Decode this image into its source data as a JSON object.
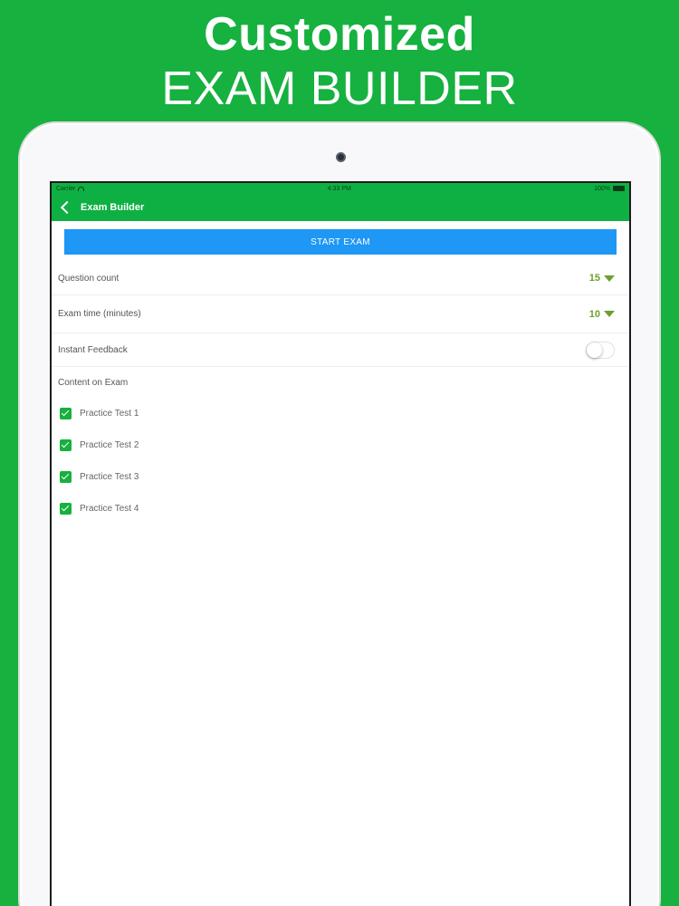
{
  "promo": {
    "line1": "Customized",
    "line2": "EXAM BUILDER"
  },
  "status_bar": {
    "carrier": "Carrier",
    "time": "4:33 PM",
    "battery": "100%"
  },
  "nav": {
    "title": "Exam Builder"
  },
  "start_button": {
    "label": "START EXAM"
  },
  "settings": {
    "question_count": {
      "label": "Question count",
      "value": "15"
    },
    "exam_time": {
      "label": "Exam time (minutes)",
      "value": "10"
    },
    "instant_feedback": {
      "label": "Instant Feedback",
      "enabled": false
    }
  },
  "content_section": {
    "label": "Content on Exam",
    "items": [
      {
        "label": "Practice Test 1",
        "checked": true
      },
      {
        "label": "Practice Test 2",
        "checked": true
      },
      {
        "label": "Practice Test 3",
        "checked": true
      },
      {
        "label": "Practice Test 4",
        "checked": true
      }
    ]
  },
  "colors": {
    "brand_green": "#16b13f",
    "button_blue": "#1e97f5",
    "dropdown_green": "#6aa12c"
  }
}
